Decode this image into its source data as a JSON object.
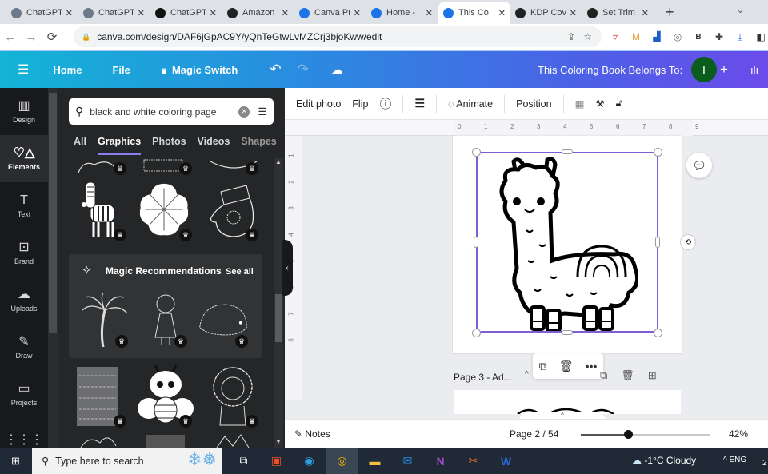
{
  "browser": {
    "tabs": [
      {
        "title": "ChatGPT",
        "icon": "chatgpt-icon",
        "color": "#6b7b8c"
      },
      {
        "title": "ChatGPT",
        "icon": "chatgpt-icon",
        "color": "#6b7b8c"
      },
      {
        "title": "ChatGPT",
        "icon": "chatgpt-icon",
        "color": "#111111"
      },
      {
        "title": "Amazon",
        "icon": "amazon-icon",
        "color": "#222222"
      },
      {
        "title": "Canva Pr",
        "icon": "canva-icon",
        "color": "#1a73e8"
      },
      {
        "title": "Home -",
        "icon": "canva-icon",
        "color": "#1a73e8"
      },
      {
        "title": "This Co",
        "icon": "canva-icon",
        "color": "#1a73e8",
        "active": true
      },
      {
        "title": "KDP Cov",
        "icon": "amazon-kdp-icon",
        "color": "#222222"
      },
      {
        "title": "Set Trim",
        "icon": "amazon-kdp-icon",
        "color": "#222222"
      }
    ],
    "new_tab": "+",
    "url": "canva.com/design/DAF6jGpAC9Y/yQnTeGtwLvMZCrj3bjoKww/edit"
  },
  "header": {
    "menu_icon": "☰",
    "home": "Home",
    "file": "File",
    "magic_switch": "Magic Switch",
    "undo": "↶",
    "redo": "↷",
    "cloud": "☁",
    "doc_title": "This Coloring Book Belongs To:",
    "avatar_initial": "I",
    "avatar_color": "#0b5d1e",
    "share_plus": "+",
    "stats": "ılı"
  },
  "rail": {
    "items": [
      {
        "label": "Design",
        "icon": "▥"
      },
      {
        "label": "Elements",
        "icon": "♡△",
        "active": true
      },
      {
        "label": "Text",
        "icon": "T"
      },
      {
        "label": "Brand",
        "icon": "⊡"
      },
      {
        "label": "Uploads",
        "icon": "☁"
      },
      {
        "label": "Draw",
        "icon": "✎"
      },
      {
        "label": "Projects",
        "icon": "▭"
      },
      {
        "label": "",
        "icon": "⋮⋮⋮"
      }
    ]
  },
  "panel": {
    "search_value": "black and white coloring page",
    "tabs": [
      "All",
      "Graphics",
      "Photos",
      "Videos",
      "Shapes"
    ],
    "active_tab": "Graphics",
    "magic_title": "Magic Recommendations",
    "see_all": "See all",
    "graphics_row1": [
      "elephant outline",
      "flowers outline",
      "bowl outline"
    ],
    "graphics_row2": [
      "zebra",
      "snowflake",
      "mitten"
    ],
    "magic_items": [
      "palm tree",
      "girl in dress",
      "hedgehog"
    ],
    "graphics_row3": [
      "pattern page",
      "bee",
      "lion"
    ]
  },
  "toolbar": {
    "edit_photo": "Edit photo",
    "flip": "Flip",
    "info": "ⓘ",
    "animate": "Animate",
    "position": "Position"
  },
  "ruler": {
    "top": [
      "0",
      "1",
      "2",
      "3",
      "4",
      "5",
      "6",
      "7",
      "8",
      "9"
    ],
    "left": [
      "1",
      "2",
      "3",
      "4",
      "5",
      "6",
      "7",
      "8"
    ]
  },
  "canvas": {
    "page3_label": "Page 3 - Ad...",
    "selected_graphic": "llama coloring illustration"
  },
  "footer": {
    "notes": "Notes",
    "page": "Page 2 / 54",
    "zoom_percent": 42,
    "zoom_label": "42%"
  },
  "taskbar": {
    "search_placeholder": "Type here to search",
    "weather": "-1°C  Cloudy",
    "lang": "ENG",
    "clock_fragment": "2"
  }
}
